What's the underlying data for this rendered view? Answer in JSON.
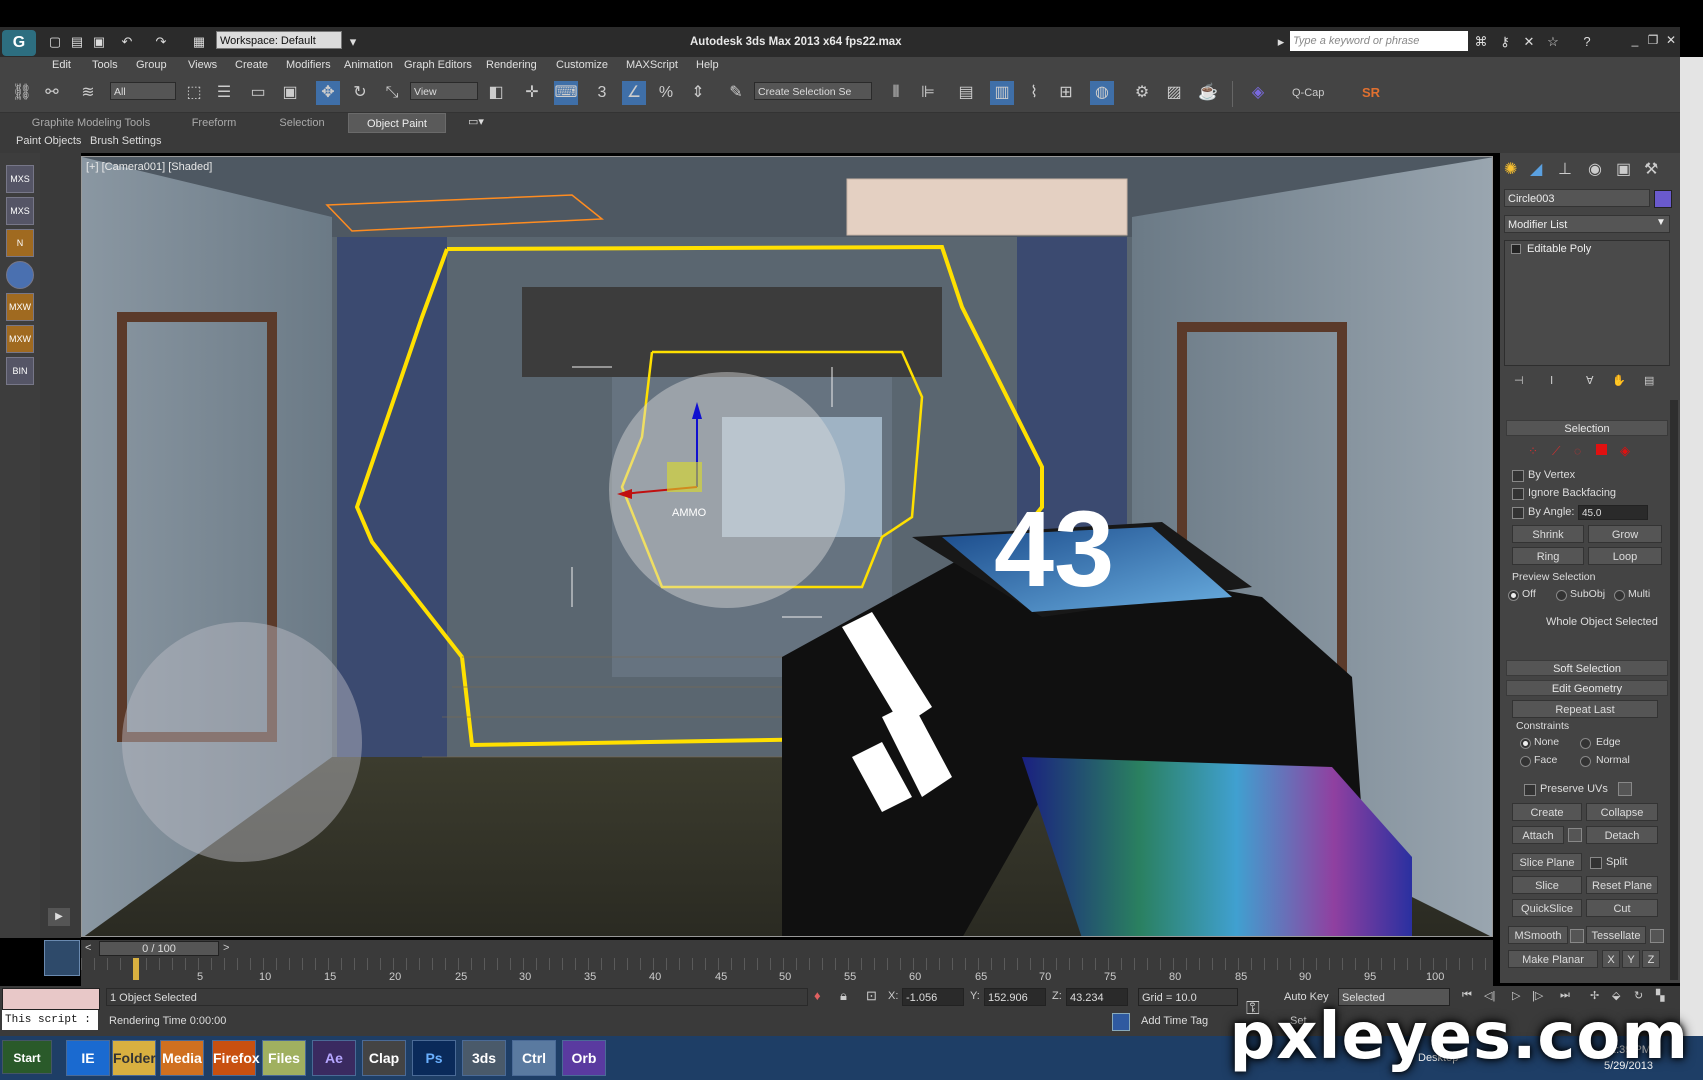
{
  "titlebar": {
    "workspace": "Workspace: Default",
    "title": "Autodesk 3ds Max  2013 x64      fps22.max",
    "search_placeholder": "Type a keyword or phrase"
  },
  "menu": [
    "Edit",
    "Tools",
    "Group",
    "Views",
    "Create",
    "Modifiers",
    "Animation",
    "Graph Editors",
    "Rendering",
    "Customize",
    "MAXScript",
    "Help"
  ],
  "toolbar": {
    "filter": "All",
    "refcoord": "View",
    "selection_set": "Create Selection Se",
    "qcap": "Q-Cap",
    "sr": "SR"
  },
  "ribbon": {
    "tabs": [
      "Graphite Modeling Tools",
      "Freeform",
      "Selection",
      "Object Paint"
    ],
    "active_tab": "Object Paint",
    "subtabs": [
      "Paint Objects",
      "Brush Settings"
    ]
  },
  "left_icons": [
    "MXS",
    "MXS",
    "N",
    "",
    "MXW",
    "MXW",
    "BIN"
  ],
  "viewport": {
    "label": "[+] [Camera001] [Shaded]",
    "hud_number": "43",
    "ammo_label": "AMMO"
  },
  "command_panel": {
    "object_name": "Circle003",
    "object_color": "#6a5acd",
    "modifier_list": "Modifier List",
    "stack_item": "Editable Poly",
    "selection_title": "Selection",
    "by_vertex": "By Vertex",
    "ignore_backfacing": "Ignore Backfacing",
    "by_angle": "By Angle:",
    "by_angle_value": "45.0",
    "shrink": "Shrink",
    "grow": "Grow",
    "ring": "Ring",
    "loop": "Loop",
    "preview_selection": "Preview Selection",
    "preview_options": [
      "Off",
      "SubObj",
      "Multi"
    ],
    "whole_object": "Whole Object Selected",
    "soft_selection": "Soft Selection",
    "edit_geometry": "Edit Geometry",
    "repeat_last": "Repeat Last",
    "constraints": "Constraints",
    "constraint_options": [
      "None",
      "Edge",
      "Face",
      "Normal"
    ],
    "preserve_uvs": "Preserve UVs",
    "create": "Create",
    "collapse": "Collapse",
    "attach": "Attach",
    "detach": "Detach",
    "slice_plane": "Slice Plane",
    "split": "Split",
    "slice": "Slice",
    "reset_plane": "Reset Plane",
    "quickslice": "QuickSlice",
    "cut": "Cut",
    "msmooth": "MSmooth",
    "tessellate": "Tessellate",
    "make_planar": "Make Planar",
    "x": "X",
    "y": "Y",
    "z": "Z"
  },
  "timeline": {
    "frame": "0 / 100",
    "ticks": [
      "5",
      "10",
      "15",
      "20",
      "25",
      "30",
      "35",
      "40",
      "45",
      "50",
      "55",
      "60",
      "65",
      "70",
      "75",
      "80",
      "85",
      "90",
      "95",
      "100"
    ]
  },
  "status": {
    "script": "This script :",
    "selected": "1 Object Selected",
    "render_time": "Rendering Time  0:00:00",
    "x_label": "X:",
    "x_value": "-1.056",
    "y_label": "Y:",
    "y_value": "152.906",
    "z_label": "Z:",
    "z_value": "43.234",
    "grid": "Grid = 10.0",
    "add_time_tag": "Add Time Tag",
    "auto_key": "Auto Key",
    "set_key": "Set",
    "key_filter": "Selected"
  },
  "taskbar": {
    "start": "Start",
    "apps": [
      "IE",
      "Folder",
      "Media",
      "Firefox",
      "Files",
      "Ae",
      "Clap",
      "Ps",
      "3ds",
      "Ctrl",
      "Orb"
    ],
    "clock_time": "2:39 PM",
    "clock_date": "5/29/2013",
    "desktop": "Desktop"
  },
  "watermark": "pxleyes.com"
}
